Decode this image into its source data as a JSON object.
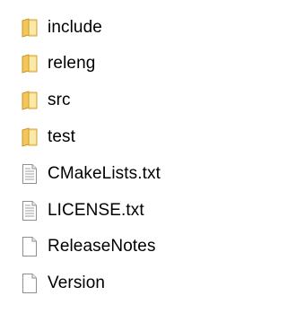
{
  "explorer": {
    "items": [
      {
        "label": "include",
        "icon": "folder-icon"
      },
      {
        "label": "releng",
        "icon": "folder-icon"
      },
      {
        "label": "src",
        "icon": "folder-icon"
      },
      {
        "label": "test",
        "icon": "folder-icon"
      },
      {
        "label": "CMakeLists.txt",
        "icon": "text-file-icon"
      },
      {
        "label": "LICENSE.txt",
        "icon": "text-file-icon"
      },
      {
        "label": "ReleaseNotes",
        "icon": "file-icon"
      },
      {
        "label": "Version",
        "icon": "file-icon"
      }
    ]
  },
  "colors": {
    "folder_light": "#f7d774",
    "folder_dark": "#d9a93b",
    "file_border": "#8d8d8d",
    "background": "#ffffff"
  }
}
